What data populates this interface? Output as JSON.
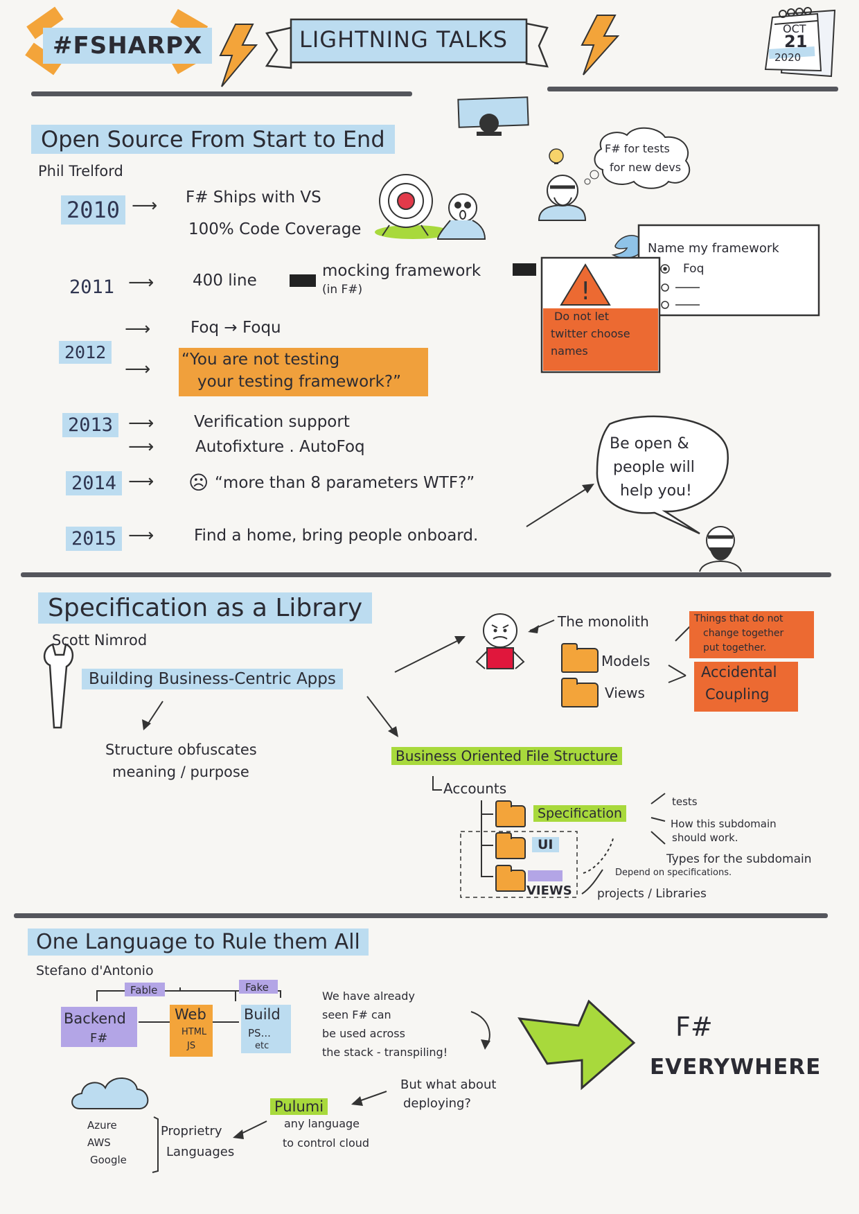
{
  "header": {
    "tag": "#FSHARPX",
    "banner": "LIGHTNING TALKS",
    "calendar_month": "OCT",
    "calendar_day": "21",
    "calendar_year": "2020"
  },
  "talk1": {
    "title": "Open Source From Start to End",
    "speaker": "Phil Trelford",
    "y2010": "2010",
    "y2010_a": "F# Ships with VS",
    "y2010_b": "100% Code Coverage",
    "y2011": "2011",
    "y2011_a": "400 line",
    "y2011_b": "mocking framework",
    "y2011_c": "(in F#)",
    "y2012": "2012",
    "y2012_a": "Foq → Foqu",
    "y2012_b1": "“You are not testing",
    "y2012_b2": "your testing framework?”",
    "y2013": "2013",
    "y2013_a": "Verification support",
    "y2013_b": "Autofixture . AutoFoq",
    "y2014": "2014",
    "y2014_a": "“more than 8 parameters WTF?”",
    "y2015": "2015",
    "y2015_a": "Find a home, bring people onboard.",
    "thought_1": "F# for tests",
    "thought_2": "for new devs",
    "twitter_title": "Name my framework",
    "twitter_opt": "Foq",
    "warning_1": "Do not let",
    "warning_2": "twitter choose",
    "warning_3": "names",
    "speech_1": "Be open &",
    "speech_2": "people will",
    "speech_3": "help you!"
  },
  "talk2": {
    "title": "Specification as a Library",
    "speaker": "Scott Nimrod",
    "building": "Building Business-Centric Apps",
    "obf_1": "Structure obfuscates",
    "obf_2": "meaning / purpose",
    "monolith": "The monolith",
    "models": "Models",
    "views": "Views",
    "things_1": "Things that do not",
    "things_2": "change together",
    "things_3": "put together.",
    "acc_1": "Accidental",
    "acc_2": "Coupling",
    "bofs": "Business Oriented File Structure",
    "accounts": "Accounts",
    "spec": "Specification",
    "ui": "UI",
    "views_caps": "VIEWS",
    "tests": "tests",
    "how_1": "How this subdomain",
    "how_2": "should work.",
    "types": "Types for the subdomain",
    "depend": "Depend on specifications.",
    "projects": "projects / Libraries"
  },
  "talk3": {
    "title": "One Language to Rule them All",
    "speaker": "Stefano d'Antonio",
    "fable": "Fable",
    "fake": "Fake",
    "backend": "Backend",
    "fsharp": "F#",
    "web": "Web",
    "html": "HTML",
    "js": "JS",
    "build": "Build",
    "ps": "PS...",
    "etc": "etc",
    "note_1": "We have already",
    "note_2": "seen F# can",
    "note_3": "be used across",
    "note_4": "the stack - transpiling!",
    "but_1": "But what about",
    "but_2": "deploying?",
    "pulumi": "Pulumi",
    "any_1": "any language",
    "any_2": "to control cloud",
    "azure": "Azure",
    "aws": "AWS",
    "google": "Google",
    "prop_1": "Proprietry",
    "prop_2": "Languages",
    "big_1": "F#",
    "big_2": "EVERYWHERE"
  }
}
